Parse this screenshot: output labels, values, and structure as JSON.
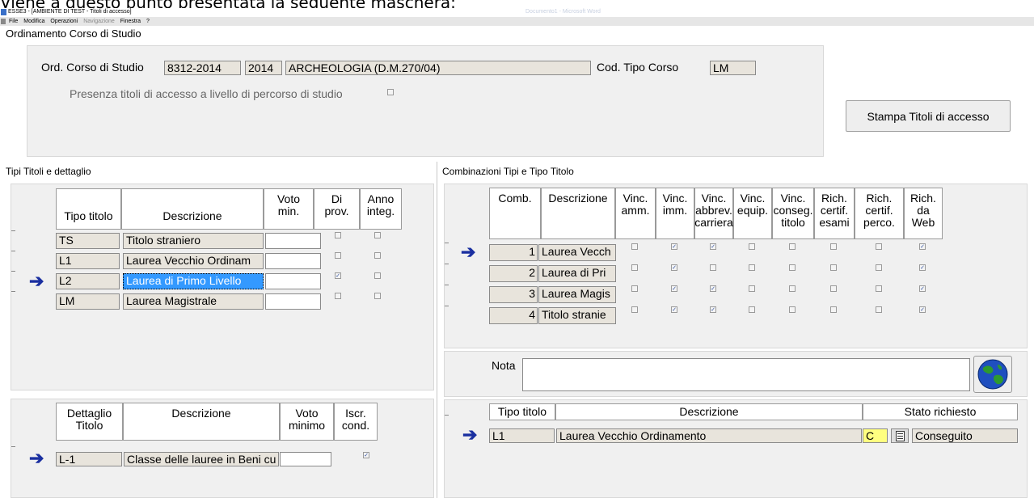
{
  "caption": "Viene a questo punto presentata la seguente maschera:",
  "window_title": "ESSE3 - [AMBIENTE DI TEST - Titoli di accesso]",
  "ghost_title": "Documento1 - Microsoft Word",
  "menu": {
    "file": "File",
    "modifica": "Modifica",
    "operazioni": "Operazioni",
    "navigazione": "Navigazione",
    "finestra": "Finestra",
    "help": "?"
  },
  "ordinamento": {
    "section_title": "Ordinamento Corso di Studio",
    "label": "Ord. Corso di Studio",
    "code": "8312-2014",
    "year": "2014",
    "name": "ARCHEOLOGIA (D.M.270/04)",
    "tipo_label": "Cod. Tipo Corso",
    "tipo_value": "LM",
    "presenza_label": "Presenza titoli di accesso a livello di percorso di studio",
    "stampa_button": "Stampa Titoli di accesso"
  },
  "tipi": {
    "section_title": "Tipi Titoli e dettaglio",
    "headers": {
      "tipo": "Tipo titolo",
      "descr": "Descrizione",
      "voto": "Voto min.",
      "prov": "Di prov.",
      "anno": "Anno integ."
    },
    "rows": [
      {
        "tipo": "TS",
        "descr": "Titolo straniero",
        "prov": false,
        "anno": false
      },
      {
        "tipo": "L1",
        "descr": "Laurea Vecchio Ordinam",
        "prov": false,
        "anno": false
      },
      {
        "tipo": "L2",
        "descr": "Laurea di Primo Livello",
        "prov": true,
        "anno": false
      },
      {
        "tipo": "LM",
        "descr": "Laurea Magistrale",
        "prov": false,
        "anno": false
      }
    ]
  },
  "dettaglio": {
    "headers": {
      "dett": "Dettaglio Titolo",
      "descr": "Descrizione",
      "voto": "Voto minimo",
      "iscr": "Iscr. cond."
    },
    "rows": [
      {
        "dett": "L-1",
        "descr": "Classe delle lauree in Beni cu",
        "iscr": true
      }
    ]
  },
  "combinazioni": {
    "section_title": "Combinazioni Tipi e Tipo Titolo",
    "headers": {
      "comb": "Comb.",
      "descr": "Descrizione",
      "amm": "Vinc. amm.",
      "imm": "Vinc. imm.",
      "abbrev": "Vinc. abbrev. carriera",
      "equip": "Vinc. equip.",
      "conseg": "Vinc. conseg. titolo",
      "esami": "Rich. certif. esami",
      "perco": "Rich. certif. perco.",
      "web": "Rich. da Web"
    },
    "rows": [
      {
        "comb": "1",
        "descr": "Laurea Vecch",
        "flags": [
          false,
          true,
          true,
          false,
          false,
          false,
          false,
          true
        ]
      },
      {
        "comb": "2",
        "descr": "Laurea di Pri",
        "flags": [
          false,
          true,
          false,
          false,
          false,
          false,
          false,
          true
        ]
      },
      {
        "comb": "3",
        "descr": "Laurea Magis",
        "flags": [
          false,
          true,
          true,
          false,
          false,
          false,
          false,
          true
        ]
      },
      {
        "comb": "4",
        "descr": "Titolo stranie",
        "flags": [
          false,
          true,
          true,
          false,
          false,
          false,
          false,
          true
        ]
      }
    ],
    "nota_label": "Nota",
    "nota_value": ""
  },
  "titoli": {
    "headers": {
      "tipo": "Tipo titolo",
      "descr": "Descrizione",
      "stato": "Stato richiesto"
    },
    "rows": [
      {
        "tipo": "L1",
        "descr": "Laurea Vecchio Ordinamento",
        "code": "C",
        "stato": "Conseguito"
      }
    ]
  },
  "colors": {
    "field_bg": "#e8e4dc",
    "panel_bg": "#f0f0f0",
    "selected_bg": "#3399ff",
    "arrow": "#1a2fa0",
    "code_bg": "#ffff80"
  }
}
